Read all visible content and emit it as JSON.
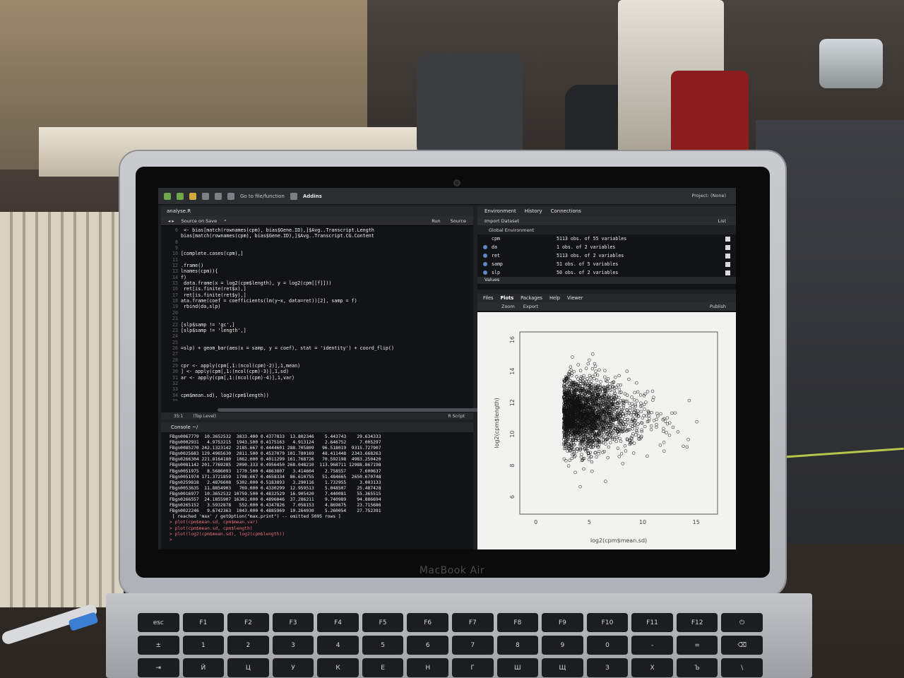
{
  "laptop": {
    "brand": "MacBook Air"
  },
  "rstudio": {
    "toolbar": {
      "go_to_file": "Go to file/function",
      "addins": "Addins",
      "project": "Project: (None)"
    },
    "editor": {
      "tab": "analyse.R",
      "source_on_save": "Source on Save",
      "run": "Run",
      "source": "Source",
      "lines": [
        {
          "n": "6",
          "t": " <- bias[match(rownames(cpm), bias$Gene.ID),]$Avg..Transcript.Length"
        },
        {
          "n": "",
          "t": "bias[match(rownames(cpm), bias$Gene.ID),]$Avg..Transcript.CG.Content"
        },
        {
          "n": "8",
          "t": ""
        },
        {
          "n": "9",
          "t": ""
        },
        {
          "n": "10",
          "t": "[complete.cases(cpm),]"
        },
        {
          "n": "11",
          "t": ""
        },
        {
          "n": "12",
          "t": ".frame()"
        },
        {
          "n": "13",
          "t": "lnames(cpm)){"
        },
        {
          "n": "14",
          "t": "f)"
        },
        {
          "n": "15",
          "t": " data.frame(x = log2(cpm$length), y = log2(cpm[[f]]))"
        },
        {
          "n": "16",
          "t": " ret[is.finite(ret$x),]"
        },
        {
          "n": "17",
          "t": " ret[is.finite(ret$y),]"
        },
        {
          "n": "18",
          "t": "ata.frame(coef = coefficients(lm(y~x, data=ret))[2], samp = f)"
        },
        {
          "n": "19",
          "t": " rbind(da,slp)"
        },
        {
          "n": "20",
          "t": ""
        },
        {
          "n": "21",
          "t": ""
        },
        {
          "n": "22",
          "t": "[slp$samp != 'gc',]"
        },
        {
          "n": "23",
          "t": "[slp$samp != 'length',]"
        },
        {
          "n": "24",
          "t": ""
        },
        {
          "n": "25",
          "t": ""
        },
        {
          "n": "26",
          "t": "=slp) + geom_bar(aes(x = samp, y = coef), stat = 'identity') + coord_flip()"
        },
        {
          "n": "27",
          "t": ""
        },
        {
          "n": "28",
          "t": ""
        },
        {
          "n": "29",
          "t": "cpr <- apply(cpm[,1:(ncol(cpm)-2)],1,mean)"
        },
        {
          "n": "30",
          "t": "] <- apply(cpm[,1:(ncol(cpm)-3)],1,sd)"
        },
        {
          "n": "31",
          "t": "ar <- apply(cpm[,1:(ncol(cpm)-4)],1,var)"
        },
        {
          "n": "32",
          "t": ""
        },
        {
          "n": "33",
          "t": ""
        },
        {
          "n": "34",
          "t": "cpm$mean.sd), log2(cpm$length))"
        },
        {
          "n": "35",
          "t": ""
        },
        {
          "n": "36",
          "t": ""
        }
      ],
      "status_pos": "35:1",
      "status_level": "(Top Level)",
      "status_type": "R Script"
    },
    "console": {
      "title": "Console ~/",
      "rows": [
        "FBgn0067779  10.3652532  3833.400 0.4377833  13.802346    5.443743    29.634333",
        "FBgn0002931   4.9753215  1943.500 0.4175163   4.913124    2.646752     7.005297",
        "FBgn0085270 242.1323142  2185.667 0.4444601 288.705809   96.518019  9315.727907",
        "FBgn0025683 129.4965630  2811.500 0.4537079 101.780169   48.411448  2343.668263",
        "FBgn0266304 221.8164180  1062.000 0.4011299 161.768726   70.592198  4983.250420",
        "FBgn0081142 201.7769285  2090.333 0.4956450 268.048210  113.968711 12988.867198",
        "FBgn0051975   8.5686093  1770.500 0.4863807   3.414604    2.758557     7.600637",
        "FBgn0051974 171.3721859  1708.667 0.4658334  86.610755   51.484665  2650.670748",
        "FBgn0259818   2.4876608  5302.000 0.5183893   3.290116    1.732955     3.003133",
        "FBgn0053635  11.8854903   769.000 0.4330299  12.959513    5.048507    25.487428",
        "FBgn0016977  10.3652532 10759.500 0.4832529  16.905420    7.440081    55.365515",
        "FBgn0266557  24.1855907 16361.000 0.4896046  37.286211    9.740989    94.886694",
        "FBgn0265152   3.5932878   552.000 0.4347826   7.058153    4.869875    23.715686",
        "FBgn0022246   9.6742363  1043.000 0.4885969  10.264030    5.260054    27.752391"
      ],
      "info": " [ reached 'max' / getOption(\"max.print\") -- omitted 5095 rows ]",
      "commands": [
        "> plot(cpm$mean.sd, cpm$mean.var)",
        "> plot(cpm$mean.sd, cpm$length)",
        "> plot(log2(cpm$mean.sd), log2(cpm$length))",
        ">"
      ]
    },
    "environment": {
      "tabs": [
        "Environment",
        "History",
        "Connections"
      ],
      "import_dataset": "Import Dataset",
      "list_label": "List",
      "scope": "Global Environment",
      "vars": [
        {
          "name": "cpm",
          "value": "5113 obs. of 55 variables"
        },
        {
          "name": "da",
          "value": "1 obs. of 2 variables"
        },
        {
          "name": "ret",
          "value": "5113 obs. of 2 variables"
        },
        {
          "name": "samp",
          "value": "51 obs. of 5 variables"
        },
        {
          "name": "slp",
          "value": "50 obs. of 2 variables"
        }
      ],
      "values_header": "Values"
    },
    "plots": {
      "tabs": [
        "Files",
        "Plots",
        "Packages",
        "Help",
        "Viewer"
      ],
      "zoom": "Zoom",
      "export": "Export",
      "publish": "Publish",
      "xlabel": "log2(cpm$mean.sd)",
      "ylabel": "log2(cpm$length)",
      "xticks": [
        "0",
        "5",
        "10",
        "15"
      ],
      "yticks": [
        "6",
        "8",
        "10",
        "12",
        "14",
        "16"
      ]
    }
  }
}
